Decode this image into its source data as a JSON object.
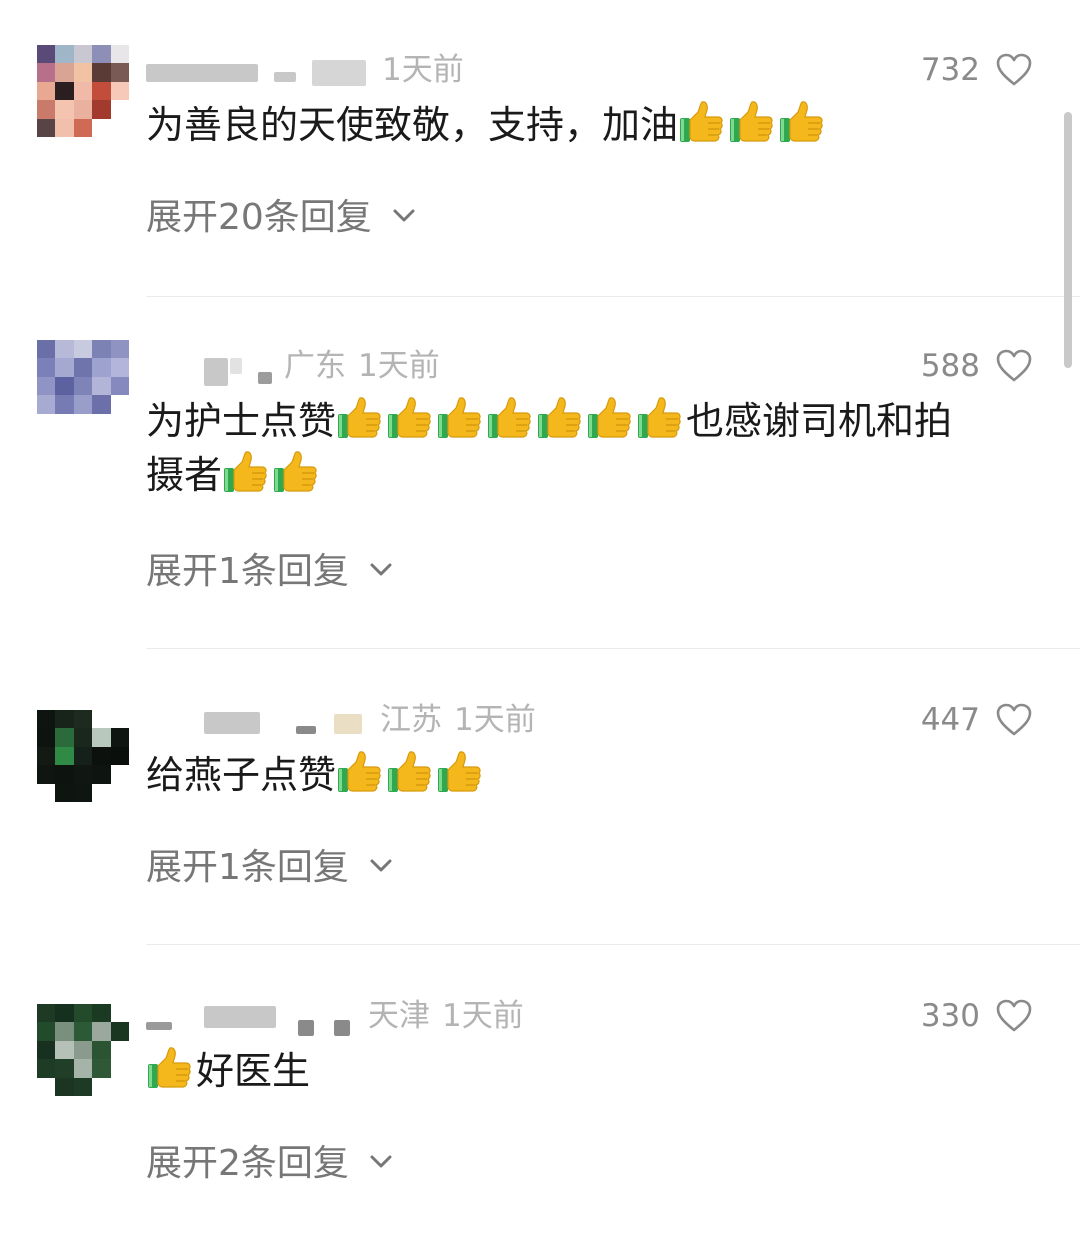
{
  "comments": [
    {
      "location": "",
      "time": "1天前",
      "likes": "732",
      "text_before": "为善良的天使致敬，支持，加油",
      "thumbs_after": 3,
      "line2_text": "",
      "line2_thumbs": 0,
      "expand_label": "展开20条回复"
    },
    {
      "location": "广东",
      "time": "1天前",
      "likes": "588",
      "text_before": "为护士点赞",
      "thumbs_after": 7,
      "text_after": "也感谢司机和拍",
      "line2_text": "摄者",
      "line2_thumbs": 2,
      "expand_label": "展开1条回复"
    },
    {
      "location": "江苏",
      "time": "1天前",
      "likes": "447",
      "text_before": "给燕子点赞",
      "thumbs_after": 3,
      "line2_text": "",
      "line2_thumbs": 0,
      "expand_label": "展开1条回复"
    },
    {
      "location": "天津",
      "time": "1天前",
      "likes": "330",
      "thumbs_before": 1,
      "text_before": "好医生",
      "thumbs_after": 0,
      "line2_text": "",
      "line2_thumbs": 0,
      "expand_label": "展开2条回复"
    }
  ],
  "icons": {
    "like": "heart-outline-icon",
    "thumbs": "thumbs-up-emoji",
    "expand": "chevron-down-icon"
  },
  "colors": {
    "text": "#1a1a1a",
    "meta": "#b4b4b4",
    "likes": "#8a8a8a",
    "expand": "#777777",
    "thumb_gold": "#f5b81c",
    "thumb_cuff": "#2fa84f"
  }
}
